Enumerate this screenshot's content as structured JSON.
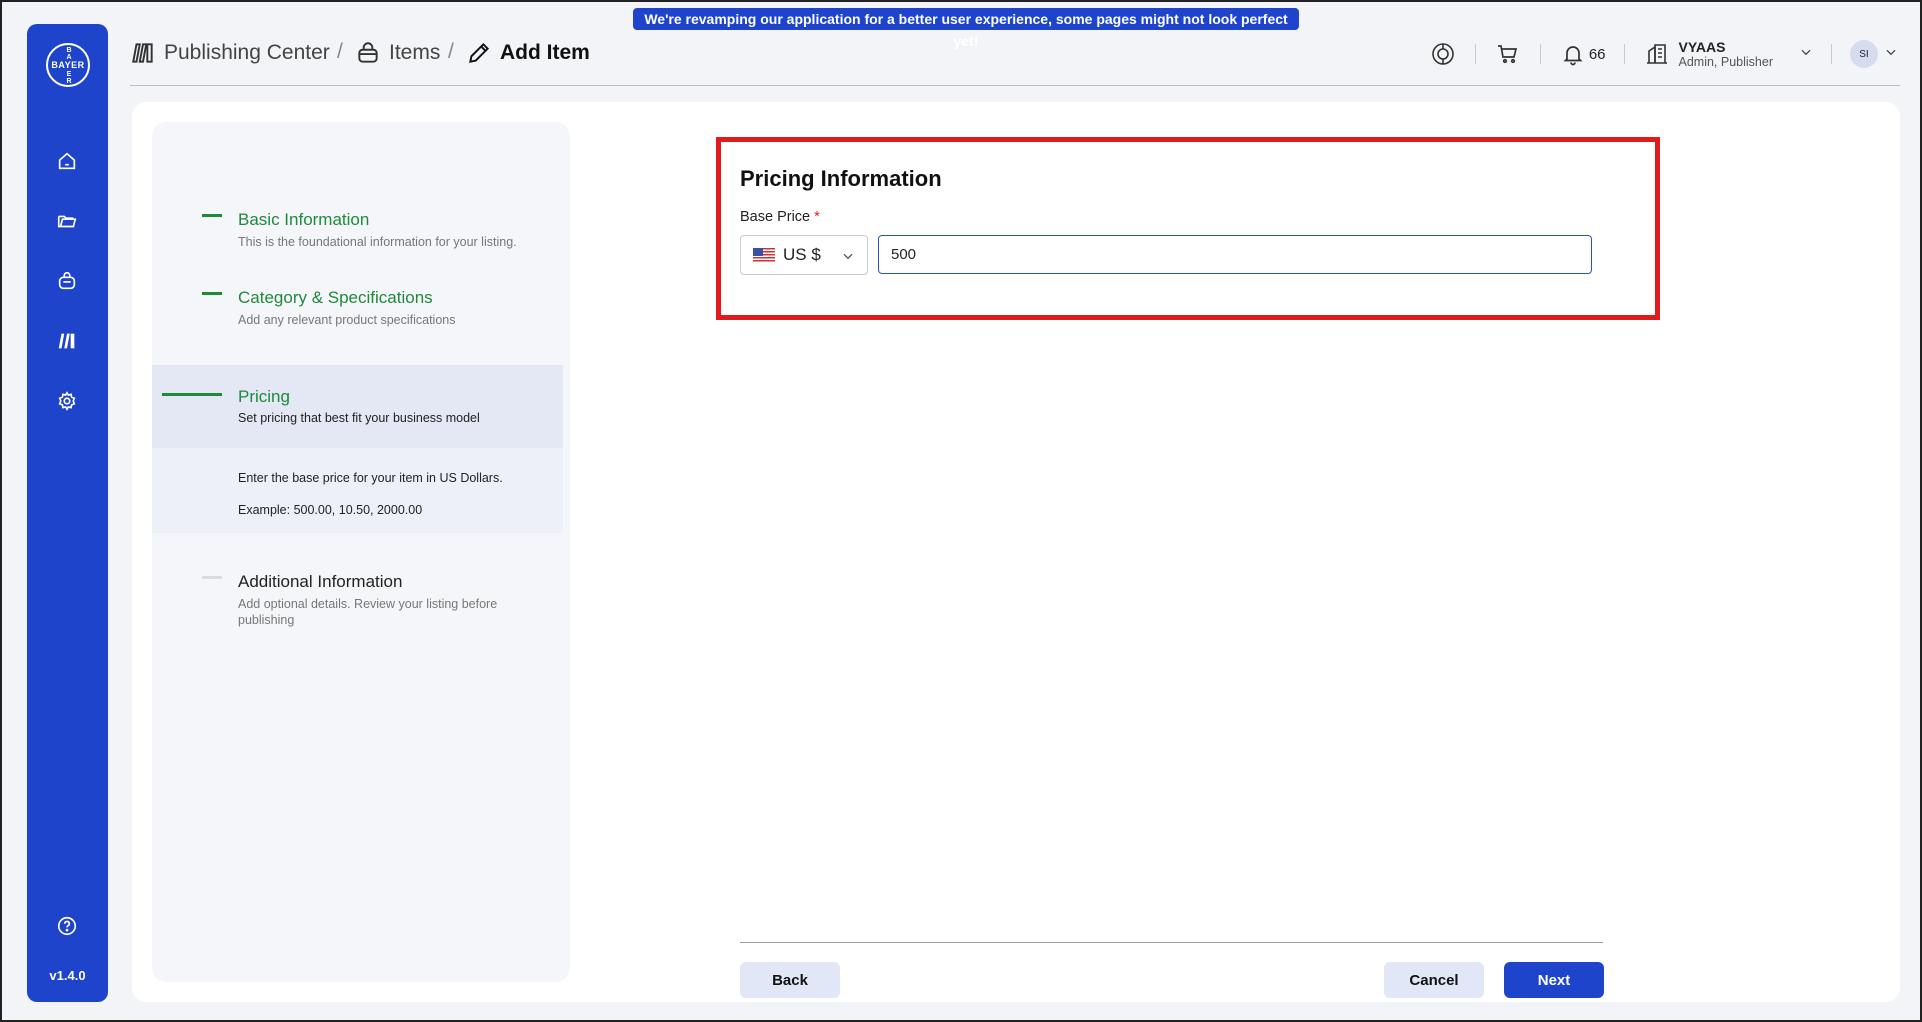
{
  "banner": "We're revamping our application for a better user experience, some pages might not look perfect yet!",
  "sidebar": {
    "logo_text": "BAYER",
    "items": [
      {
        "icon": "home-icon"
      },
      {
        "icon": "folder-icon"
      },
      {
        "icon": "bag-icon"
      },
      {
        "icon": "publishing-icon"
      },
      {
        "icon": "gear-icon"
      }
    ],
    "help_icon": "help-icon",
    "version": "v1.4.0"
  },
  "breadcrumb": {
    "items": [
      {
        "label": "Publishing Center",
        "icon": "publishing-icon"
      },
      {
        "label": "Items",
        "icon": "basket-icon"
      },
      {
        "label": "Add Item",
        "icon": "pencil-icon"
      }
    ],
    "separator": "/"
  },
  "header": {
    "notification_count": "66",
    "org_name": "VYAAS",
    "org_role": "Admin, Publisher",
    "avatar_initials": "SI"
  },
  "steps": [
    {
      "title": "Basic Information",
      "desc": "This is the foundational information for your listing.",
      "status": "complete"
    },
    {
      "title": "Category & Specifications",
      "desc": "Add any relevant product specifications",
      "status": "complete"
    },
    {
      "title": "Pricing",
      "desc": "Set pricing that best fit your business model",
      "status": "active",
      "help_line1": "Enter the base price for your item in US Dollars.",
      "help_line2": "Example: 500.00, 10.50, 2000.00"
    },
    {
      "title": "Additional Information",
      "desc": "Add optional details. Review your listing before publishing",
      "status": "pending"
    }
  ],
  "pricing": {
    "title": "Pricing Information",
    "label": "Base Price",
    "required_mark": "*",
    "currency": "US $",
    "value": "500"
  },
  "actions": {
    "back": "Back",
    "cancel": "Cancel",
    "next": "Next"
  },
  "colors": {
    "brand": "#1f44cc",
    "step_complete": "#1e8a3a",
    "highlight": "#e01b1b"
  }
}
